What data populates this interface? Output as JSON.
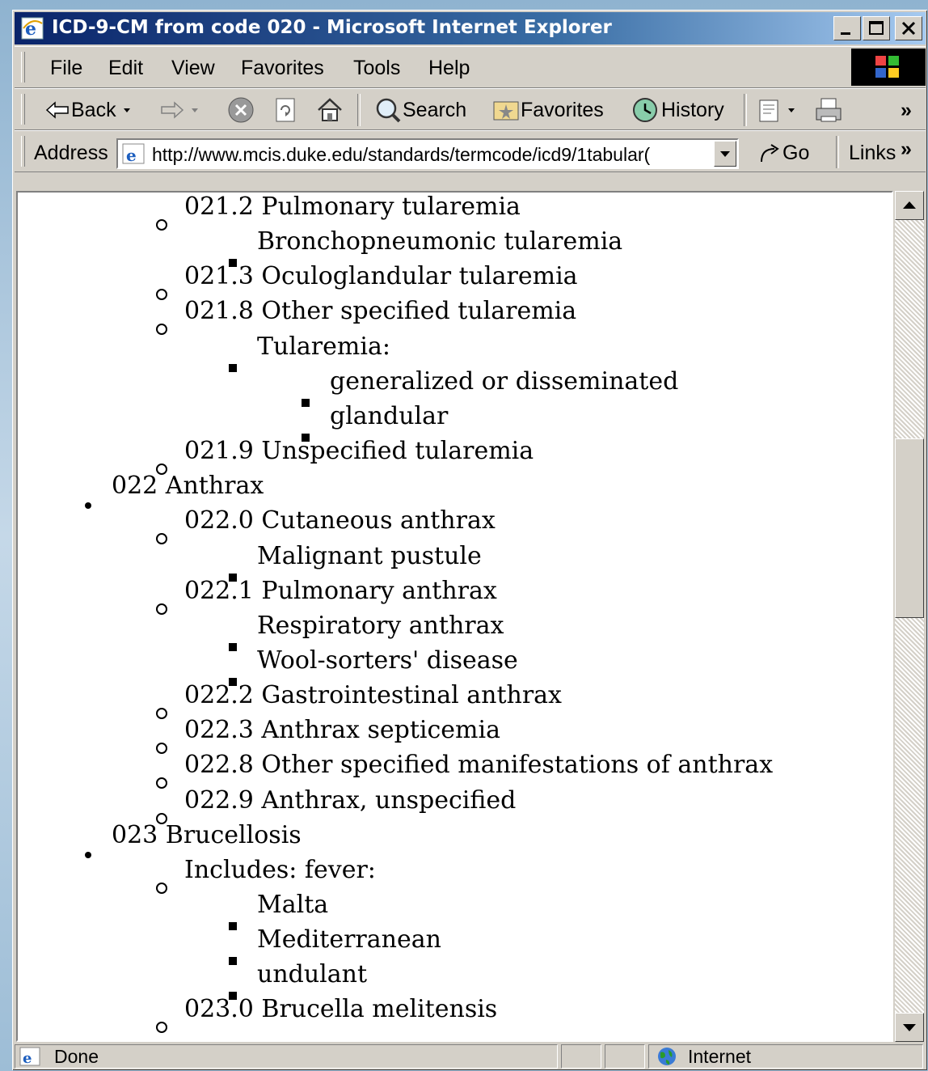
{
  "window": {
    "title": "ICD-9-CM from code 020 - Microsoft Internet Explorer"
  },
  "menu": {
    "items": [
      "File",
      "Edit",
      "View",
      "Favorites",
      "Tools",
      "Help"
    ]
  },
  "toolbar": {
    "back_label": "Back",
    "search_label": "Search",
    "favorites_label": "Favorites",
    "history_label": "History"
  },
  "address_bar": {
    "label": "Address",
    "url": "http://www.mcis.duke.edu/standards/termcode/icd9/1tabular(",
    "go_label": "Go",
    "links_label": "Links"
  },
  "document": {
    "lines": [
      {
        "level": 2,
        "text": "021.2 Pulmonary tularemia"
      },
      {
        "level": 3,
        "text": "Bronchopneumonic tularemia"
      },
      {
        "level": 2,
        "text": "021.3 Oculoglandular tularemia"
      },
      {
        "level": 2,
        "text": "021.8 Other specified tularemia"
      },
      {
        "level": 3,
        "text": "Tularemia:"
      },
      {
        "level": 4,
        "text": "generalized or disseminated"
      },
      {
        "level": 4,
        "text": "glandular"
      },
      {
        "level": 2,
        "text": "021.9 Unspecified tularemia"
      },
      {
        "level": 1,
        "text": "022 Anthrax"
      },
      {
        "level": 2,
        "text": "022.0 Cutaneous anthrax"
      },
      {
        "level": 3,
        "text": "Malignant pustule"
      },
      {
        "level": 2,
        "text": "022.1 Pulmonary anthrax"
      },
      {
        "level": 3,
        "text": "Respiratory anthrax"
      },
      {
        "level": 3,
        "text": "Wool-sorters' disease"
      },
      {
        "level": 2,
        "text": "022.2 Gastrointestinal anthrax"
      },
      {
        "level": 2,
        "text": "022.3 Anthrax septicemia"
      },
      {
        "level": 2,
        "text": "022.8 Other specified manifestations of anthrax"
      },
      {
        "level": 2,
        "text": "022.9 Anthrax, unspecified"
      },
      {
        "level": 1,
        "text": "023 Brucellosis"
      },
      {
        "level": 2,
        "text": "Includes: fever:"
      },
      {
        "level": 3,
        "text": "Malta"
      },
      {
        "level": 3,
        "text": "Mediterranean"
      },
      {
        "level": 3,
        "text": "undulant"
      },
      {
        "level": 2,
        "text": "023.0 Brucella melitensis"
      }
    ]
  },
  "status_bar": {
    "status": "Done",
    "zone": "Internet"
  }
}
